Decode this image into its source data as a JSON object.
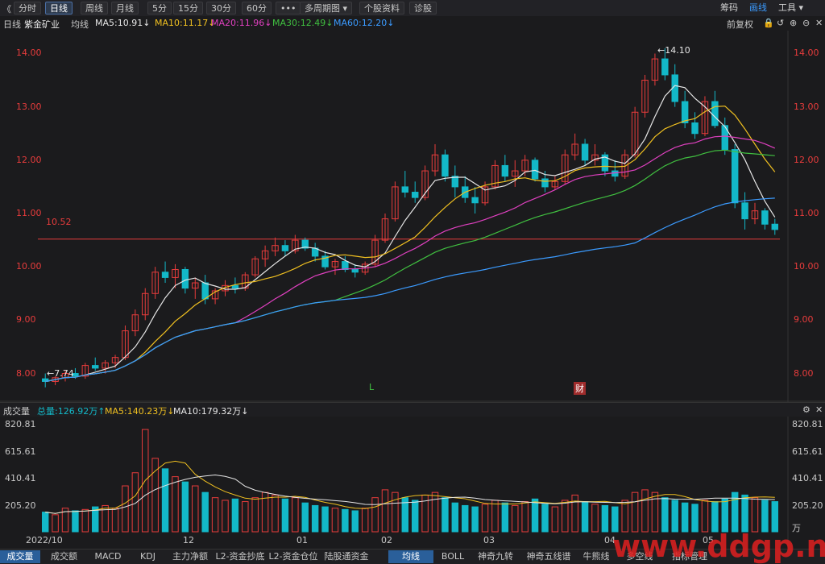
{
  "toolbar": {
    "collapse": "《",
    "periods": [
      "分时",
      "日线",
      "周线",
      "月线",
      "5分",
      "15分",
      "30分",
      "60分"
    ],
    "active_period": "日线",
    "more": "•••",
    "multi": "多周期图 ▾",
    "info": "个股资料",
    "diag": "诊股",
    "right": [
      "筹码",
      "画线",
      "工具 ▾"
    ],
    "right_active": "画线"
  },
  "ma_line": {
    "chart": "日线",
    "name": "紫金矿业",
    "avg": "均线",
    "items": [
      {
        "label": "MA5:10.91↓",
        "color": "#e6e6e6"
      },
      {
        "label": "MA10:11.17↓",
        "color": "#f0c020"
      },
      {
        "label": "MA20:11.96↓",
        "color": "#e040c0"
      },
      {
        "label": "MA30:12.49↓",
        "color": "#40c040"
      },
      {
        "label": "MA60:12.20↓",
        "color": "#3b9bff"
      }
    ],
    "adjust": "前复权"
  },
  "colors": {
    "up": "#e83c3c",
    "down": "#13b8c8",
    "ma5": "#e6e6e6",
    "ma10": "#f0c020",
    "ma20": "#e040c0",
    "ma30": "#40c040",
    "ma60": "#3b9bff"
  },
  "price_axis": {
    "ticks": [
      "14.00",
      "13.00",
      "12.00",
      "11.00",
      "10.00",
      "9.00",
      "8.00"
    ]
  },
  "annotations": {
    "high": "14.10",
    "low": "7.74",
    "ref": "10.52",
    "l_mark": "L",
    "cai_mark": "财"
  },
  "volume_line": {
    "title": "成交量",
    "total": "总量:126.92万↑",
    "ma5": "MA5:140.23万↓",
    "ma10": "MA10:179.32万↓"
  },
  "volume_axis": {
    "ticks": [
      "820.81",
      "615.61",
      "410.41",
      "205.20"
    ],
    "unit": "万"
  },
  "date_axis": [
    "2022/10",
    "12",
    "01",
    "02",
    "03",
    "04",
    "05"
  ],
  "bottom_tabs": [
    "成交量",
    "成交额",
    "MACD",
    "KDJ",
    "主力净额",
    "L2-资金抄底",
    "L2-资金仓位",
    "陆股通资金",
    "均线",
    "BOLL",
    "神奇九转",
    "神奇五线谱",
    "牛熊线",
    "多空线",
    "指标管理"
  ],
  "bottom_active": [
    "成交量",
    "均线"
  ],
  "watermark": "www.ddgp.net",
  "chart_data": {
    "type": "candlestick",
    "ohlc": [
      [
        7.9,
        8.0,
        7.74,
        7.85
      ],
      [
        7.85,
        7.95,
        7.78,
        7.92
      ],
      [
        7.92,
        8.05,
        7.85,
        8.0
      ],
      [
        8.0,
        8.1,
        7.9,
        7.95
      ],
      [
        7.95,
        8.2,
        7.9,
        8.15
      ],
      [
        8.15,
        8.3,
        8.05,
        8.1
      ],
      [
        8.1,
        8.25,
        8.0,
        8.2
      ],
      [
        8.2,
        8.35,
        8.1,
        8.3
      ],
      [
        8.3,
        8.9,
        8.25,
        8.8
      ],
      [
        8.8,
        9.2,
        8.7,
        9.1
      ],
      [
        9.1,
        9.6,
        9.0,
        9.5
      ],
      [
        9.5,
        10.0,
        9.4,
        9.9
      ],
      [
        9.9,
        10.1,
        9.7,
        9.8
      ],
      [
        9.8,
        10.05,
        9.6,
        9.95
      ],
      [
        9.95,
        10.0,
        9.5,
        9.6
      ],
      [
        9.6,
        9.8,
        9.4,
        9.7
      ],
      [
        9.7,
        9.85,
        9.3,
        9.4
      ],
      [
        9.4,
        9.6,
        9.3,
        9.55
      ],
      [
        9.55,
        9.75,
        9.45,
        9.65
      ],
      [
        9.65,
        9.8,
        9.5,
        9.6
      ],
      [
        9.6,
        9.9,
        9.55,
        9.85
      ],
      [
        9.85,
        10.2,
        9.8,
        10.15
      ],
      [
        10.15,
        10.4,
        10.0,
        10.3
      ],
      [
        10.3,
        10.55,
        10.2,
        10.4
      ],
      [
        10.4,
        10.5,
        10.2,
        10.3
      ],
      [
        10.3,
        10.6,
        10.25,
        10.5
      ],
      [
        10.5,
        10.55,
        10.3,
        10.35
      ],
      [
        10.35,
        10.45,
        10.1,
        10.2
      ],
      [
        10.2,
        10.3,
        9.95,
        10.0
      ],
      [
        10.0,
        10.15,
        9.85,
        10.1
      ],
      [
        10.1,
        10.2,
        9.9,
        9.95
      ],
      [
        9.95,
        10.05,
        9.8,
        9.9
      ],
      [
        9.9,
        10.1,
        9.85,
        10.05
      ],
      [
        10.05,
        10.6,
        10.0,
        10.5
      ],
      [
        10.5,
        11.0,
        10.45,
        10.9
      ],
      [
        10.9,
        11.6,
        10.85,
        11.5
      ],
      [
        11.5,
        11.8,
        11.3,
        11.4
      ],
      [
        11.4,
        11.6,
        11.2,
        11.3
      ],
      [
        11.3,
        11.9,
        11.25,
        11.8
      ],
      [
        11.8,
        12.3,
        11.7,
        12.1
      ],
      [
        12.1,
        12.2,
        11.6,
        11.7
      ],
      [
        11.7,
        11.9,
        11.3,
        11.5
      ],
      [
        11.5,
        11.7,
        11.2,
        11.3
      ],
      [
        11.3,
        11.5,
        11.0,
        11.2
      ],
      [
        11.2,
        11.6,
        11.15,
        11.5
      ],
      [
        11.5,
        12.0,
        11.45,
        11.9
      ],
      [
        11.9,
        12.1,
        11.6,
        11.7
      ],
      [
        11.7,
        12.0,
        11.5,
        11.8
      ],
      [
        11.8,
        12.1,
        11.7,
        12.0
      ],
      [
        12.0,
        12.05,
        11.6,
        11.65
      ],
      [
        11.65,
        11.8,
        11.4,
        11.5
      ],
      [
        11.5,
        11.7,
        11.45,
        11.6
      ],
      [
        11.6,
        12.2,
        11.55,
        12.1
      ],
      [
        12.1,
        12.5,
        12.0,
        12.3
      ],
      [
        12.3,
        12.4,
        11.9,
        12.0
      ],
      [
        12.0,
        12.3,
        11.9,
        12.1
      ],
      [
        12.1,
        12.15,
        11.7,
        11.8
      ],
      [
        11.8,
        12.0,
        11.6,
        11.7
      ],
      [
        11.7,
        12.2,
        11.65,
        12.1
      ],
      [
        12.1,
        13.0,
        12.05,
        12.9
      ],
      [
        12.9,
        13.6,
        12.8,
        13.5
      ],
      [
        13.5,
        14.0,
        13.4,
        13.9
      ],
      [
        13.9,
        14.1,
        13.5,
        13.6
      ],
      [
        13.6,
        13.8,
        13.0,
        13.1
      ],
      [
        13.1,
        13.3,
        12.6,
        12.7
      ],
      [
        12.7,
        12.9,
        12.4,
        12.5
      ],
      [
        12.5,
        13.2,
        12.45,
        13.1
      ],
      [
        13.1,
        13.3,
        12.6,
        12.65
      ],
      [
        12.65,
        12.8,
        12.1,
        12.2
      ],
      [
        12.2,
        12.3,
        11.1,
        11.2
      ],
      [
        11.2,
        11.4,
        10.7,
        10.9
      ],
      [
        10.9,
        11.2,
        10.8,
        11.05
      ],
      [
        11.05,
        11.1,
        10.7,
        10.8
      ],
      [
        10.8,
        10.9,
        10.6,
        10.7
      ]
    ],
    "volume": [
      150,
      130,
      180,
      160,
      170,
      190,
      200,
      180,
      350,
      450,
      780,
      560,
      480,
      420,
      380,
      350,
      300,
      260,
      240,
      250,
      230,
      260,
      300,
      280,
      250,
      260,
      220,
      200,
      190,
      180,
      170,
      160,
      180,
      260,
      320,
      300,
      260,
      240,
      280,
      300,
      260,
      220,
      200,
      190,
      210,
      240,
      220,
      200,
      230,
      250,
      210,
      190,
      240,
      280,
      230,
      210,
      200,
      190,
      240,
      300,
      320,
      300,
      260,
      240,
      220,
      210,
      240,
      230,
      250,
      300,
      280,
      260,
      240,
      230
    ],
    "price_axis_range": [
      7.6,
      14.4
    ],
    "volume_axis_range": [
      0,
      860
    ]
  }
}
